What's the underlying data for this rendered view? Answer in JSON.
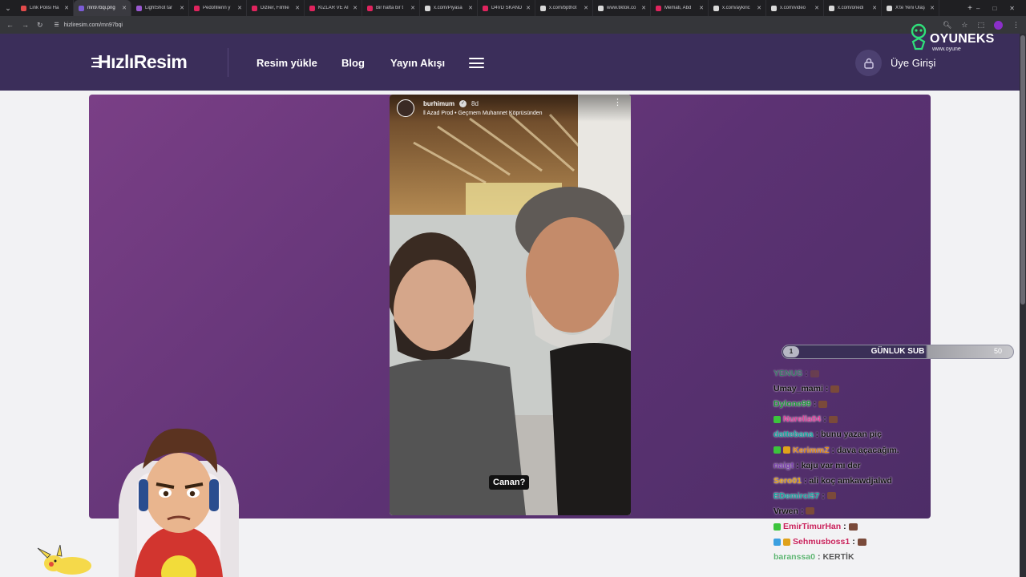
{
  "browser": {
    "tabs": [
      {
        "label": "Link Polisi Ha",
        "color": "#e24b4b",
        "active": false
      },
      {
        "label": "mn97bqi.png",
        "color": "#7b5cd6",
        "active": true
      },
      {
        "label": "LightShot tar",
        "color": "#9a59d1",
        "active": false
      },
      {
        "label": "Pedofillerin y",
        "color": "#e0245e",
        "active": false
      },
      {
        "label": "Diziler, Filmle",
        "color": "#e0245e",
        "active": false
      },
      {
        "label": "KIZLAR VE AI",
        "color": "#e0245e",
        "active": false
      },
      {
        "label": "Bir hafta bir t",
        "color": "#e0245e",
        "active": false
      },
      {
        "label": "x.com/Piyasa",
        "color": "#d9d9d9",
        "active": false
      },
      {
        "label": "D4VD SKAND",
        "color": "#e0245e",
        "active": false
      },
      {
        "label": "x.com/bpthot",
        "color": "#d9d9d9",
        "active": false
      },
      {
        "label": "www.tiktok.co",
        "color": "#d9d9d9",
        "active": false
      },
      {
        "label": "Memati, Abd",
        "color": "#e0245e",
        "active": false
      },
      {
        "label": "x.com/aykiric",
        "color": "#d9d9d9",
        "active": false
      },
      {
        "label": "x.com/video",
        "color": "#d9d9d9",
        "active": false
      },
      {
        "label": "x.com/onedi",
        "color": "#d9d9d9",
        "active": false
      },
      {
        "label": "X'te Yeni Ulaş",
        "color": "#d9d9d9",
        "active": false
      }
    ],
    "url": "hizliresim.com/mn97bqi"
  },
  "header": {
    "logo": "HızlıResim",
    "nav": [
      "Resim yükle",
      "Blog",
      "Yayın Akışı"
    ],
    "login": "Üye Girişi"
  },
  "overlay_logo": {
    "name": "OYUNEKS",
    "sub": "www.oyune"
  },
  "story": {
    "username": "burhimum",
    "time": "8d",
    "music": "Azad Prod • Geçmem Muhannet Köprüsünden",
    "caption": "Canan?"
  },
  "sub_goal": {
    "current": "1",
    "title": "GÜNLUK SUB",
    "goal": "50",
    "fraction": 0.02
  },
  "chat": [
    {
      "user": "YENUS",
      "color": "#2fb36b",
      "message": "",
      "emote": true,
      "badges": []
    },
    {
      "user": "Umay_mami",
      "color": "#111111",
      "message": "",
      "emote": true,
      "badges": []
    },
    {
      "user": "Dylone99",
      "color": "#1e9a3a",
      "message": "",
      "emote": true,
      "badges": []
    },
    {
      "user": "Nurella04",
      "color": "#e0409a",
      "message": "",
      "emote": true,
      "badges": [
        "#3cc43c"
      ]
    },
    {
      "user": "dattebana",
      "color": "#16a9a0",
      "message": "bunu yazan piç",
      "emote": false,
      "badges": []
    },
    {
      "user": "KerimmZ",
      "color": "#e08a1a",
      "message": "dava açacağım.",
      "emote": false,
      "badges": [
        "#3cc43c",
        "#e0a21a"
      ]
    },
    {
      "user": "naigt",
      "color": "#7a3fb0",
      "message": "kaju var mı der",
      "emote": false,
      "badges": []
    },
    {
      "user": "Sero01",
      "color": "#e0a21a",
      "message": "ali koç amkawdjalwd",
      "emote": false,
      "badges": []
    },
    {
      "user": "EDemirci57",
      "color": "#16a9a0",
      "message": "",
      "emote": true,
      "badges": []
    },
    {
      "user": "Vrwen",
      "color": "#111111",
      "message": "",
      "emote": true,
      "badges": []
    },
    {
      "user": "EmirTimurHan",
      "color": "#c8205a",
      "message": "",
      "emote": true,
      "badges": [
        "#3cc43c"
      ]
    },
    {
      "user": "Sehmusboss1",
      "color": "#c8205a",
      "message": "",
      "emote": true,
      "badges": [
        "#3ca0e0",
        "#e0a21a"
      ]
    },
    {
      "user": "baranssa0",
      "color": "#1e9a3a",
      "message": "KERTİK",
      "emote": false,
      "badges": []
    }
  ]
}
